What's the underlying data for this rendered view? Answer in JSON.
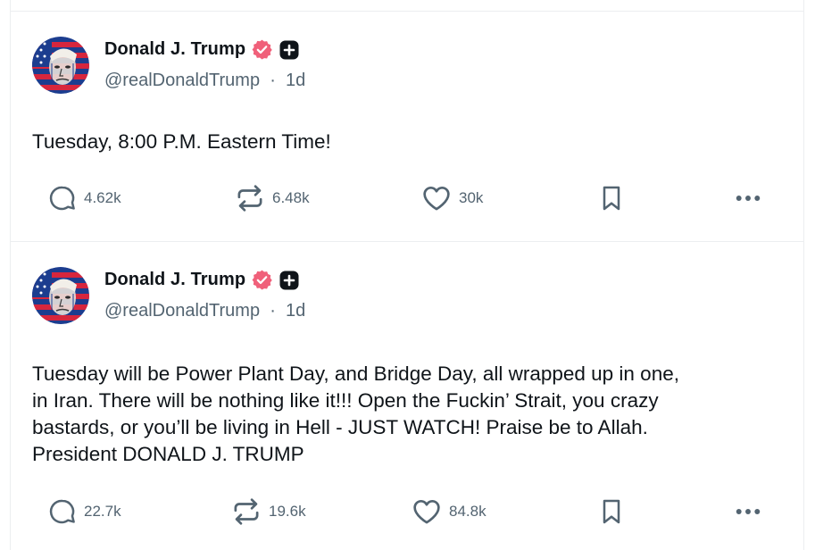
{
  "posts": [
    {
      "author": {
        "name": "Donald J. Trump",
        "handle": "@realDonaldTrump",
        "time": "1d"
      },
      "text": "Tuesday, 8:00 P.M. Eastern Time!",
      "stats": {
        "replies": "4.62k",
        "reposts": "6.48k",
        "likes": "30k"
      }
    },
    {
      "author": {
        "name": "Donald J. Trump",
        "handle": "@realDonaldTrump",
        "time": "1d"
      },
      "text_lines": [
        "Tuesday will be Power Plant Day, and Bridge Day, all wrapped up in one,",
        "in Iran. There will be nothing like it!!! Open the Fuckin’ Strait, you crazy",
        "bastards, or you’ll be living in Hell - JUST WATCH! Praise be to Allah.",
        "President DONALD J. TRUMP"
      ],
      "stats": {
        "replies": "22.7k",
        "reposts": "19.6k",
        "likes": "84.8k"
      }
    }
  ],
  "separator": "·",
  "colors": {
    "verified_badge": "#f0607a",
    "text": "#0f1419",
    "muted": "#536471",
    "border": "#eceef0"
  },
  "icons": [
    "avatar",
    "verified-badge-icon",
    "plus-badge-icon",
    "reply-icon",
    "repost-icon",
    "like-icon",
    "bookmark-icon",
    "more-icon"
  ]
}
